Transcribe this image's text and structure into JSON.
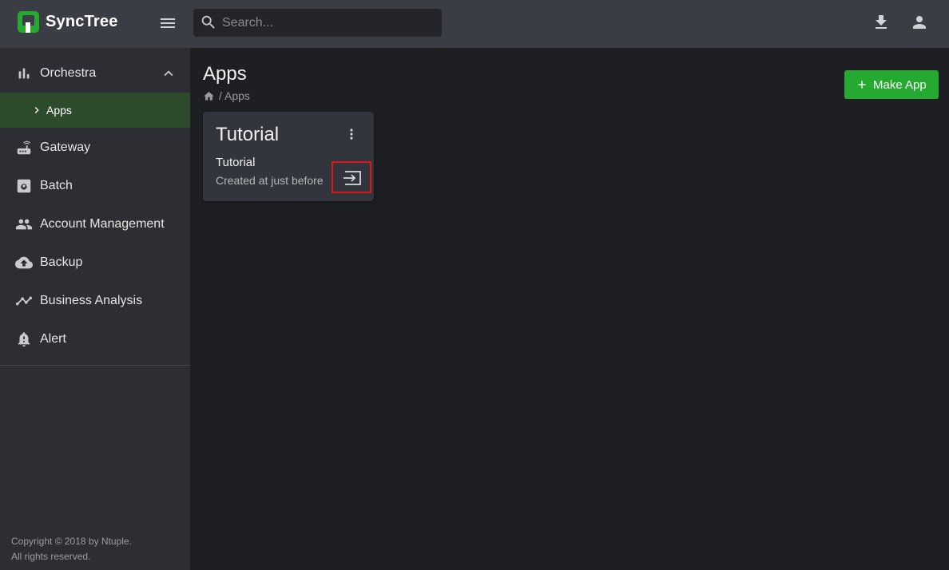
{
  "brand": {
    "name": "SyncTree",
    "logo_icon": "synctree-logo-icon",
    "accent": "#25a930"
  },
  "topbar": {
    "menu_icon": "hamburger-menu-icon",
    "search": {
      "placeholder": "Search...",
      "value": ""
    },
    "download_icon": "download-icon",
    "account_icon": "account-icon"
  },
  "sidebar": {
    "items": [
      {
        "label": "Orchestra",
        "icon": "bar-chart-icon",
        "expanded": true
      },
      {
        "label": "Gateway",
        "icon": "router-icon"
      },
      {
        "label": "Batch",
        "icon": "batch-gear-icon"
      },
      {
        "label": "Account Management",
        "icon": "people-icon"
      },
      {
        "label": "Backup",
        "icon": "cloud-upload-icon"
      },
      {
        "label": "Business Analysis",
        "icon": "trend-line-icon"
      },
      {
        "label": "Alert",
        "icon": "bell-icon"
      }
    ],
    "subitems": [
      {
        "label": "Apps",
        "active": true
      }
    ],
    "copyright": [
      "Copyright © 2018 by Ntuple.",
      "All rights reserved."
    ]
  },
  "main": {
    "title": "Apps",
    "breadcrumb": "/ Apps",
    "make_app_label": "Make App",
    "cards": [
      {
        "title": "Tutorial",
        "subtitle": "Tutorial",
        "meta": "Created at just before"
      }
    ]
  }
}
